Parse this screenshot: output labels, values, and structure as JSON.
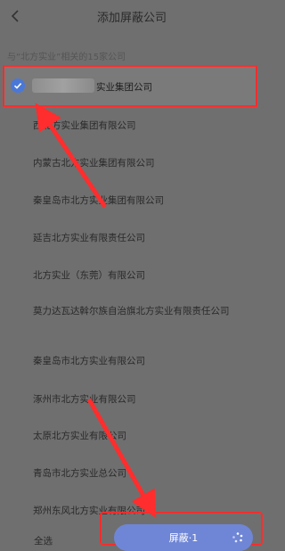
{
  "header": {
    "title": "添加屏蔽公司"
  },
  "subtitle": "与“北方实业”相关的15家公司",
  "selected": {
    "label_suffix": "实业集团公司"
  },
  "companies": [
    "西北方实业集团有限公司",
    "内蒙古北方实业集团有限公司",
    "秦皇岛市北方实业集团有限公司",
    "延吉北方实业有限责任公司",
    "北方实业（东莞）有限公司",
    "莫力达瓦达斡尔族自治旗北方实业有限责任公司",
    "秦皇岛市北方实业有限公司",
    "涿州市北方实业有限公司",
    "太原北方实业有限公司",
    "青岛市北方实业总公司",
    "郑州东风北方实业有限公司"
  ],
  "footer": {
    "select_all": "全选",
    "block_button": "屏蔽·1"
  },
  "colors": {
    "accent": "#4a78d8",
    "button": "#6f86d6",
    "highlight": "#ff2d2d"
  }
}
